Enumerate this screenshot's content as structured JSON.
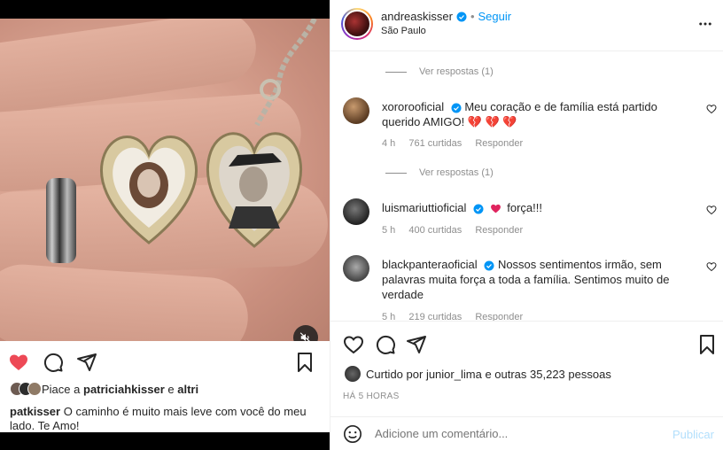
{
  "post": {
    "caption_liked_prefix": "Piace a",
    "caption_liked_user": "patriciahkisser",
    "caption_liked_and": "e",
    "caption_liked_others": "altri",
    "caption_user": "patkisser",
    "caption_text": "O caminho é muito mais leve com você do meu lado. Te Amo!"
  },
  "header": {
    "username": "andreaskisser",
    "separator": "•",
    "follow_label": "Seguir",
    "location": "São Paulo"
  },
  "comments": [
    {
      "replies_label": "Ver respostas (1)"
    },
    {
      "user": "xororooficial",
      "text": "Meu coração e de família está partido querido AMIGO! 💔 💔 💔",
      "time": "4 h",
      "likes": "761 curtidas",
      "reply": "Responder",
      "replies_label": "Ver respostas (1)"
    },
    {
      "user": "luismariuttioficial",
      "text": "força!!!",
      "time": "5 h",
      "likes": "400 curtidas",
      "reply": "Responder"
    },
    {
      "user": "blackpanteraoficial",
      "text": "Nossos sentimentos irmão, sem palavras muita força a toda a família. Sentimos muito de verdade",
      "time": "5 h",
      "likes": "219 curtidas",
      "reply": "Responder"
    }
  ],
  "likes": {
    "prefix": "Curtido por",
    "user": "junior_lima",
    "suffix": "e outras 35,223 pessoas"
  },
  "time_ago": "HÁ 5 HORAS",
  "add_comment": {
    "placeholder": "Adicione um comentário...",
    "publish_label": "Publicar"
  },
  "colors": {
    "accent": "#0095f6",
    "liked_heart": "#ed4956",
    "publish_disabled": "#b2dffc",
    "muted_text": "#8e8e8e"
  }
}
